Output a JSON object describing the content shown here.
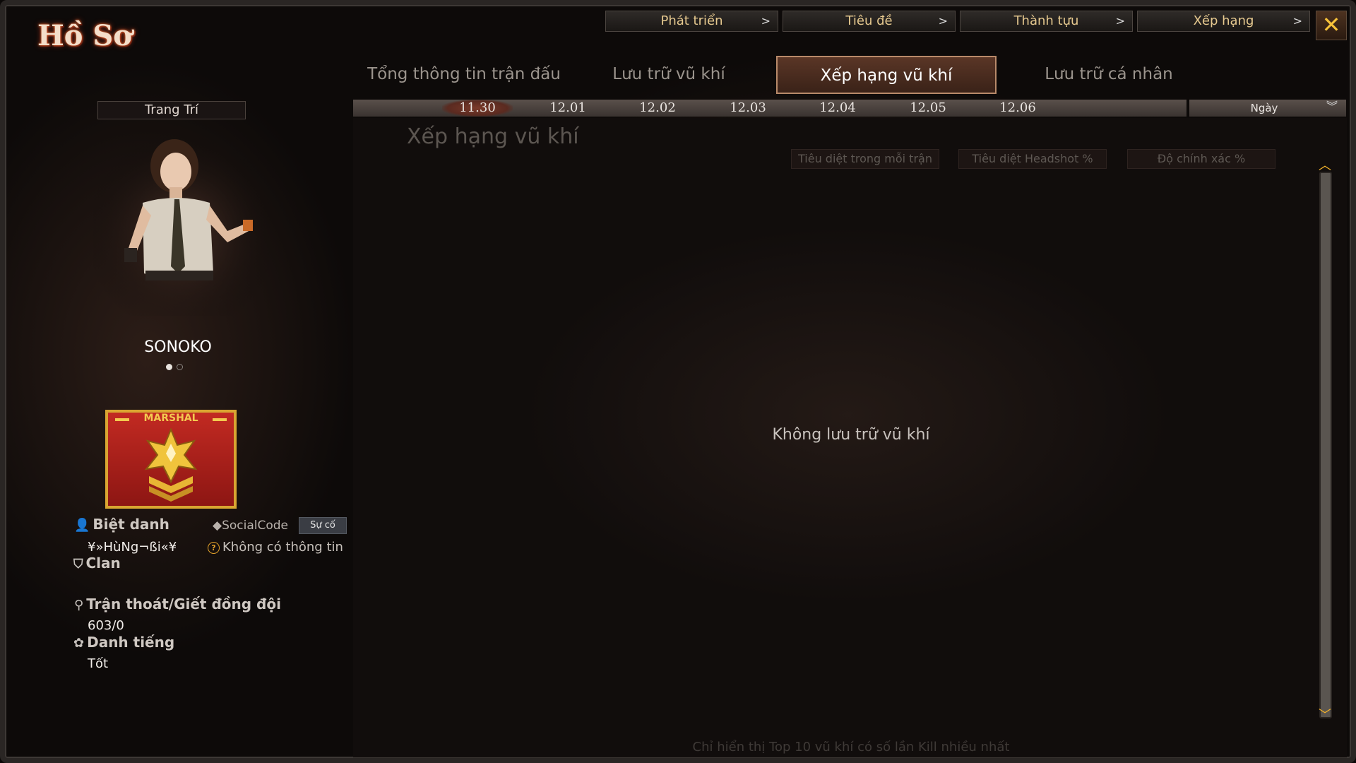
{
  "app": {
    "title": "Hồ Sơ"
  },
  "top_nav": [
    {
      "label": "Phát triển"
    },
    {
      "label": "Tiêu đề"
    },
    {
      "label": "Thành tựu"
    },
    {
      "label": "Xếp hạng"
    }
  ],
  "close_glyph": "✕",
  "tabs": [
    {
      "label": "Tổng thông tin trận đấu",
      "active": false
    },
    {
      "label": "Lưu trữ vũ khí",
      "active": false
    },
    {
      "label": "Xếp hạng vũ khí",
      "active": true
    },
    {
      "label": "Lưu trữ cá nhân",
      "active": false
    }
  ],
  "dates": [
    "11.30",
    "12.01",
    "12.02",
    "12.03",
    "12.04",
    "12.05",
    "12.06"
  ],
  "selected_date": "11.30",
  "period_select": {
    "value": "Ngày"
  },
  "content": {
    "heading": "Xếp hạng vũ khí",
    "sort_buttons": [
      "Tiêu diệt trong mỗi trận",
      "Tiêu diệt Headshot %",
      "Độ chính xác %"
    ],
    "empty_message": "Không lưu trữ vũ khí",
    "footnote": "Chỉ hiển thị Top 10 vũ khí có số lần Kill nhiều nhất"
  },
  "sidebar": {
    "decor_button": "Trang Trí",
    "character_name": "SONOKO",
    "rank": "MARSHAL",
    "nickname_label": "Biệt danh",
    "nickname_value": "¥»HùNg¬ßi«¥",
    "social_label": "SocialCode",
    "report_button": "Sự cố",
    "social_value": "Không có thông tin",
    "clan_label": "Clan",
    "escape_label": "Trận thoát/Giết đồng đội",
    "escape_value": "603/0",
    "reputation_label": "Danh tiếng",
    "reputation_value": "Tốt"
  },
  "colors": {
    "accent_gold": "#f3b22a",
    "tab_active_border": "#b88a6a",
    "badge_red": "#c22a22"
  }
}
